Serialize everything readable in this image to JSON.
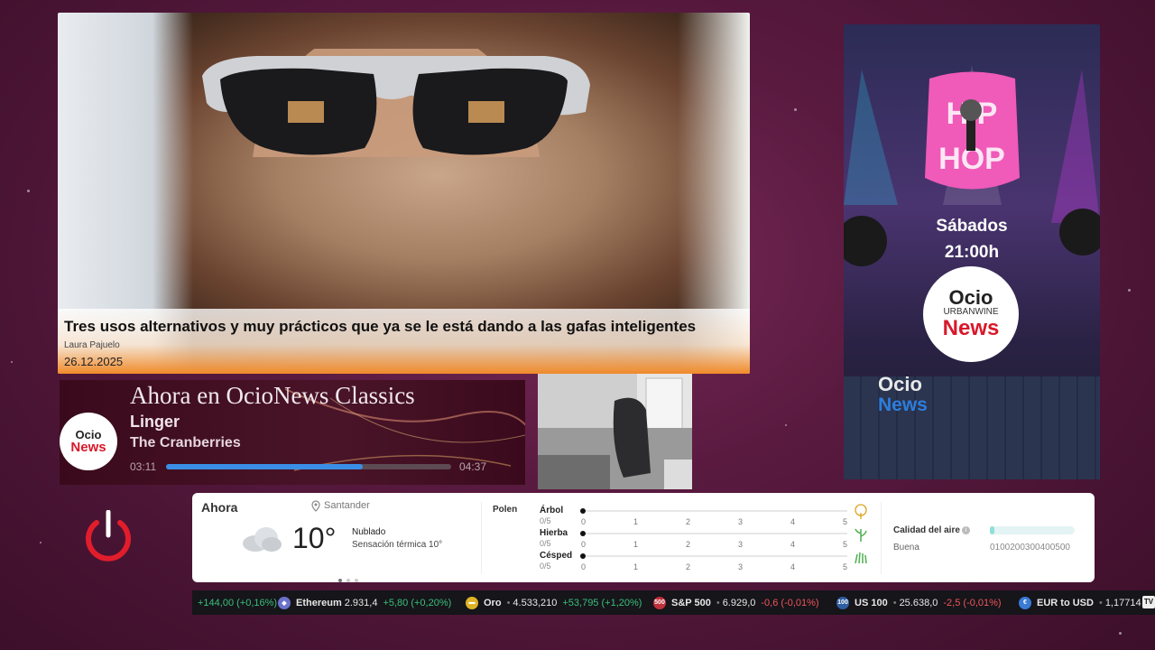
{
  "news": {
    "title": "Tres usos alternativos y muy prácticos que ya se le está dando a las gafas inteligentes",
    "author": "Laura Pajuelo",
    "date": "26.12.2025"
  },
  "now_playing": {
    "heading": "Ahora en OcioNews Classics",
    "song": "Linger",
    "artist": "The Cranberries",
    "elapsed": "03:11",
    "duration": "04:37",
    "progress": 0.69,
    "logo_top": "Ocio",
    "logo_bottom": "News"
  },
  "promo": {
    "days": "Sábados",
    "hour": "21:00h",
    "circle_top": "Ocio",
    "circle_sub": "URBANWINE",
    "circle_bottom": "News",
    "logo_top": "Ocio",
    "logo_bottom": "News"
  },
  "weather": {
    "now_label": "Ahora",
    "location": "Santander",
    "temperature": "10°",
    "condition": "Nublado",
    "feels_like": "Sensación térmica 10°",
    "pollen_label": "Polen",
    "pollen": [
      {
        "name": "Árbol",
        "value": "0/5"
      },
      {
        "name": "Hierba",
        "value": "0/5"
      },
      {
        "name": "Césped",
        "value": "0/5"
      }
    ],
    "scale": [
      "0",
      "1",
      "2",
      "3",
      "4",
      "5"
    ],
    "air_label": "Calidad del aire",
    "air_state": "Buena",
    "air_scale": "0100200300400500",
    "air_level": 0.05
  },
  "ticker": [
    {
      "name": "",
      "price": "",
      "change": "+144,00 (+0,16%)",
      "dir": "up",
      "icon": "",
      "color": ""
    },
    {
      "name": "Ethereum",
      "price": "2.931,4",
      "change": "+5,80 (+0,20%)",
      "dir": "up",
      "icon": "ethereum-icon",
      "color": "#6b72c9"
    },
    {
      "name": "Oro",
      "price": "4.533,210",
      "change": "+53,795 (+1,20%)",
      "dir": "up",
      "icon": "gold-icon",
      "color": "#e0b326"
    },
    {
      "name": "S&P 500",
      "price": "6.929,0",
      "change": "-0,6 (-0,01%)",
      "dir": "down",
      "icon": "sp500-icon",
      "color": "#c0303a",
      "badge": "500"
    },
    {
      "name": "US 100",
      "price": "25.638,0",
      "change": "-2,5 (-0,01%)",
      "dir": "down",
      "icon": "us100-icon",
      "color": "#2f5ea0",
      "badge": "100"
    },
    {
      "name": "EUR to USD",
      "price": "1,17714",
      "change": "",
      "dir": "up",
      "icon": "eurusd-icon",
      "color": "#3a7bd5"
    }
  ],
  "colors": {
    "accent_orange": "#f08a2a",
    "brand_red": "#d8182a",
    "progress_blue": "#3a8ee6",
    "up_green": "#3cbf7a",
    "down_red": "#f0555a"
  }
}
